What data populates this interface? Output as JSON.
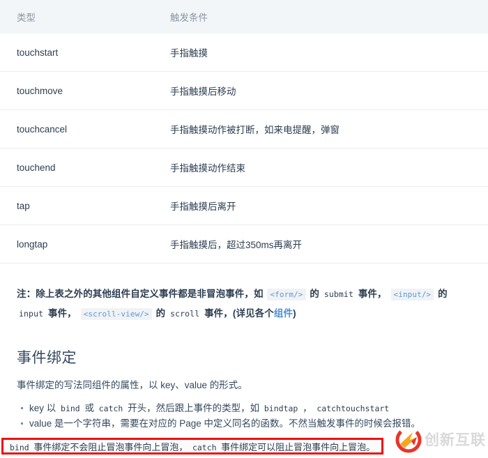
{
  "table": {
    "headers": [
      "类型",
      "触发条件"
    ],
    "rows": [
      {
        "type": "touchstart",
        "condition": "手指触摸"
      },
      {
        "type": "touchmove",
        "condition": "手指触摸后移动"
      },
      {
        "type": "touchcancel",
        "condition": "手指触摸动作被打断，如来电提醒，弹窗"
      },
      {
        "type": "touchend",
        "condition": "手指触摸动作结束"
      },
      {
        "type": "tap",
        "condition": "手指触摸后离开"
      },
      {
        "type": "longtap",
        "condition": "手指触摸后，超过350ms再离开"
      }
    ]
  },
  "note": {
    "part1": "注：除上表之外的其他组件自定义事件都是非冒泡事件，如 ",
    "code_form": "<form/>",
    "part2": " 的 ",
    "code_submit": "submit",
    "part3": " 事件， ",
    "code_input": "<input/>",
    "part4": " 的 ",
    "code_input_evt": "input",
    "part5": " 事件， ",
    "code_scrollview": "<scroll-view/>",
    "part6": " 的 ",
    "code_scroll": "scroll",
    "part7": " 事件，(详见各个",
    "link_text": "组件",
    "part8": ")"
  },
  "section": {
    "heading": "事件绑定",
    "lead": "事件绑定的写法同组件的属性，以 key、value 的形式。"
  },
  "bullets": [
    {
      "p1": "key 以 ",
      "c1": "bind",
      "p2": " 或 ",
      "c2": "catch",
      "p3": " 开头，然后跟上事件的类型，如 ",
      "c3": "bindtap",
      "p4": " ， ",
      "c4": "catchtouchstart",
      "p5": ""
    },
    {
      "p1": "value 是一个字符串，需要在对应的 Page 中定义同名的函数。不然当触发事件的时候会报错。",
      "c1": "",
      "p2": "",
      "c2": "",
      "p3": "",
      "c3": "",
      "p4": "",
      "c4": "",
      "p5": ""
    }
  ],
  "highlight": {
    "code_bind": "bind",
    "text1": " 事件绑定不会阻止冒泡事件向上冒泡，  ",
    "code_catch": "catch",
    "text2": " 事件绑定可以阻止冒泡事件向上冒泡。",
    "border_color": "#ee1111"
  },
  "watermark": {
    "text": "创新互联"
  }
}
